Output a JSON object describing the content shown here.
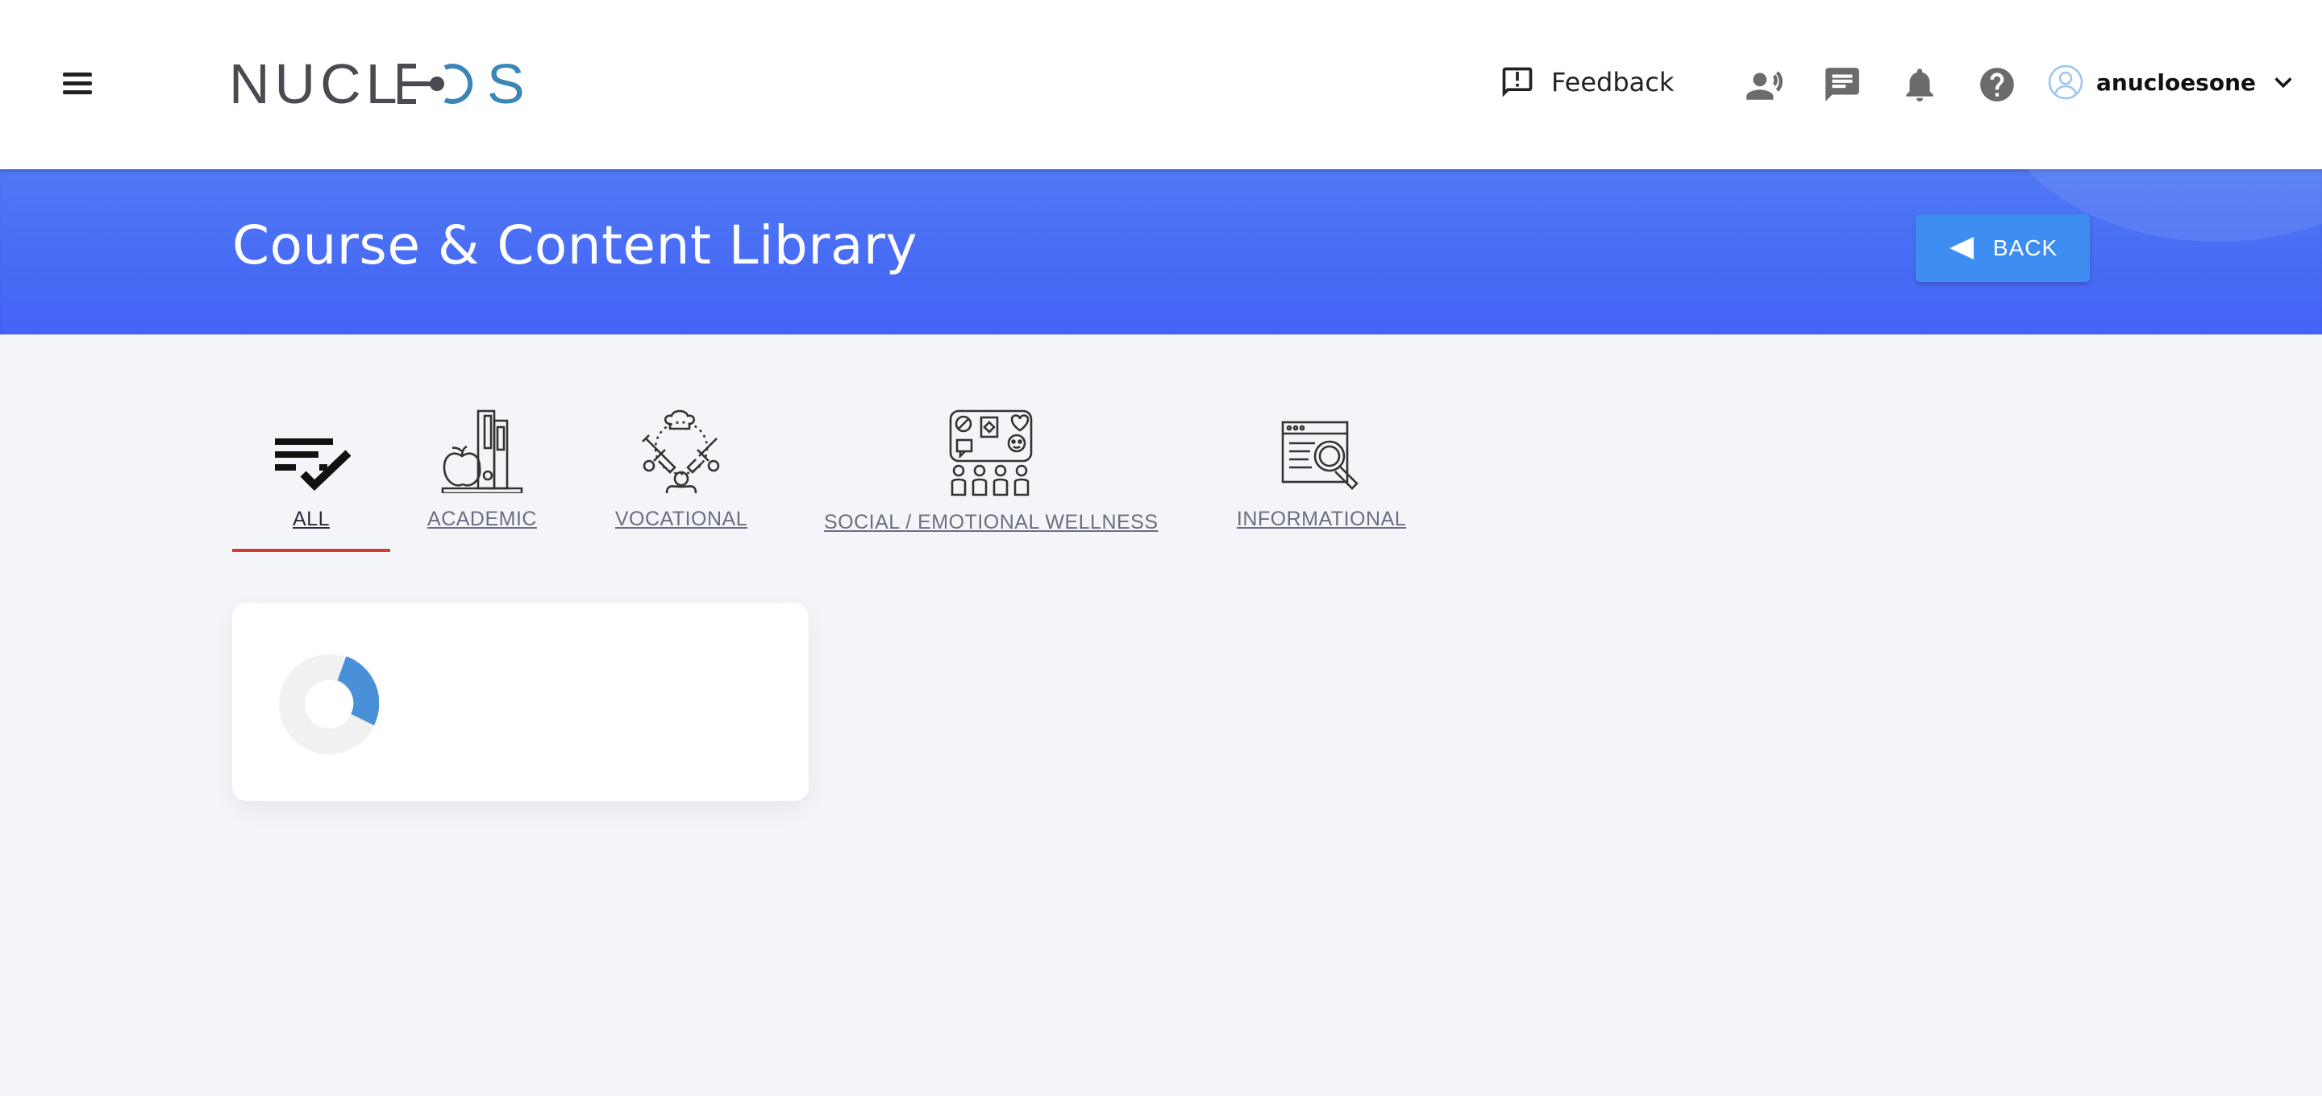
{
  "header": {
    "brand": "NUCLEOS",
    "feedback_label": "Feedback",
    "username": "anucloesone",
    "icons": [
      "menu-icon",
      "feedback-icon",
      "voice-icon",
      "messages-icon",
      "notifications-icon",
      "help-icon",
      "user-avatar-icon",
      "chevron-down-icon"
    ]
  },
  "banner": {
    "title": "Course & Content Library",
    "back_label": "BACK"
  },
  "tabs": [
    {
      "label": "ALL",
      "icon": "checklist-icon",
      "active": true
    },
    {
      "label": "ACADEMIC",
      "icon": "books-apple-icon",
      "active": false
    },
    {
      "label": "VOCATIONAL",
      "icon": "tools-chef-icon",
      "active": false
    },
    {
      "label": "SOCIAL / EMOTIONAL WELLNESS",
      "icon": "group-board-icon",
      "active": false
    },
    {
      "label": "INFORMATIONAL",
      "icon": "browser-search-icon",
      "active": false
    }
  ],
  "colors": {
    "banner": "#4767f5",
    "back_button": "#3d8ef0",
    "active_tab_underline": "#d93a2f",
    "spinner": "#4a90d9"
  }
}
